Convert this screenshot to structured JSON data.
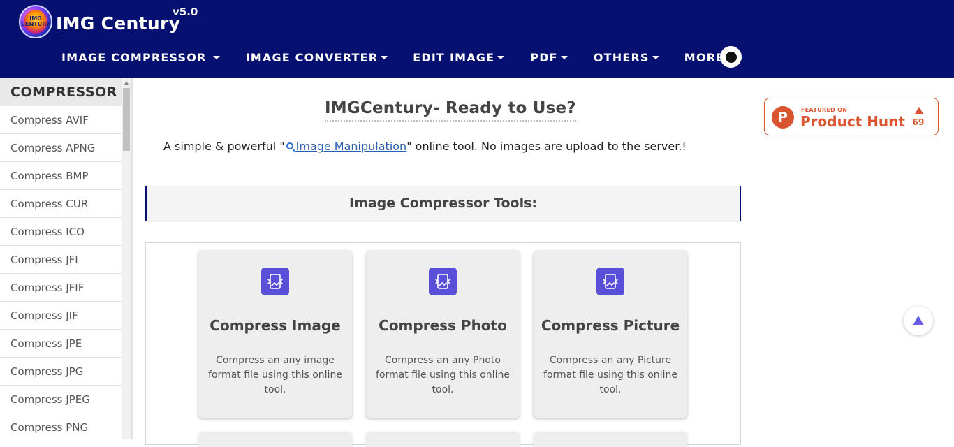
{
  "brand": {
    "name": "IMG Century",
    "version": "v5.0",
    "logo_text": "IMG CENTURY"
  },
  "nav": [
    {
      "label": "IMAGE COMPRESSOR"
    },
    {
      "label": "IMAGE CONVERTER"
    },
    {
      "label": "EDIT IMAGE"
    },
    {
      "label": "PDF"
    },
    {
      "label": "OTHERS"
    },
    {
      "label": "MORE"
    }
  ],
  "sidebar": {
    "heading": "COMPRESSOR",
    "items": [
      {
        "label": "Compress AVIF"
      },
      {
        "label": "Compress APNG"
      },
      {
        "label": "Compress BMP"
      },
      {
        "label": "Compress CUR"
      },
      {
        "label": "Compress ICO"
      },
      {
        "label": "Compress JFI"
      },
      {
        "label": "Compress JFIF"
      },
      {
        "label": "Compress JIF"
      },
      {
        "label": "Compress JPE"
      },
      {
        "label": "Compress JPG"
      },
      {
        "label": "Compress JPEG"
      },
      {
        "label": "Compress PNG"
      }
    ]
  },
  "main": {
    "title": "IMGCentury- Ready to Use?",
    "tagline_before": "A simple & powerful \"",
    "tagline_link": "Image Manipulation",
    "tagline_after": "\" online tool. No images are upload to the server.!",
    "tools_heading": "Image Compressor Tools:",
    "cards": [
      {
        "title": "Compress Image",
        "description": "Compress an any image format file using this online tool."
      },
      {
        "title": "Compress Photo",
        "description": "Compress an any Photo format file using this online tool."
      },
      {
        "title": "Compress Picture",
        "description": "Compress an any Picture format file using this online tool."
      }
    ]
  },
  "product_hunt": {
    "featured": "FEATURED ON",
    "name": "Product Hunt",
    "votes": "69",
    "color": "#da552f"
  },
  "colors": {
    "header_bg": "#061070",
    "icon_bg": "#5a4fd8",
    "link": "#2a5db0"
  },
  "icons": {
    "theme_toggle": "circle-icon",
    "card_icon": "image-compress-icon",
    "float_button": "triangle-icon"
  }
}
